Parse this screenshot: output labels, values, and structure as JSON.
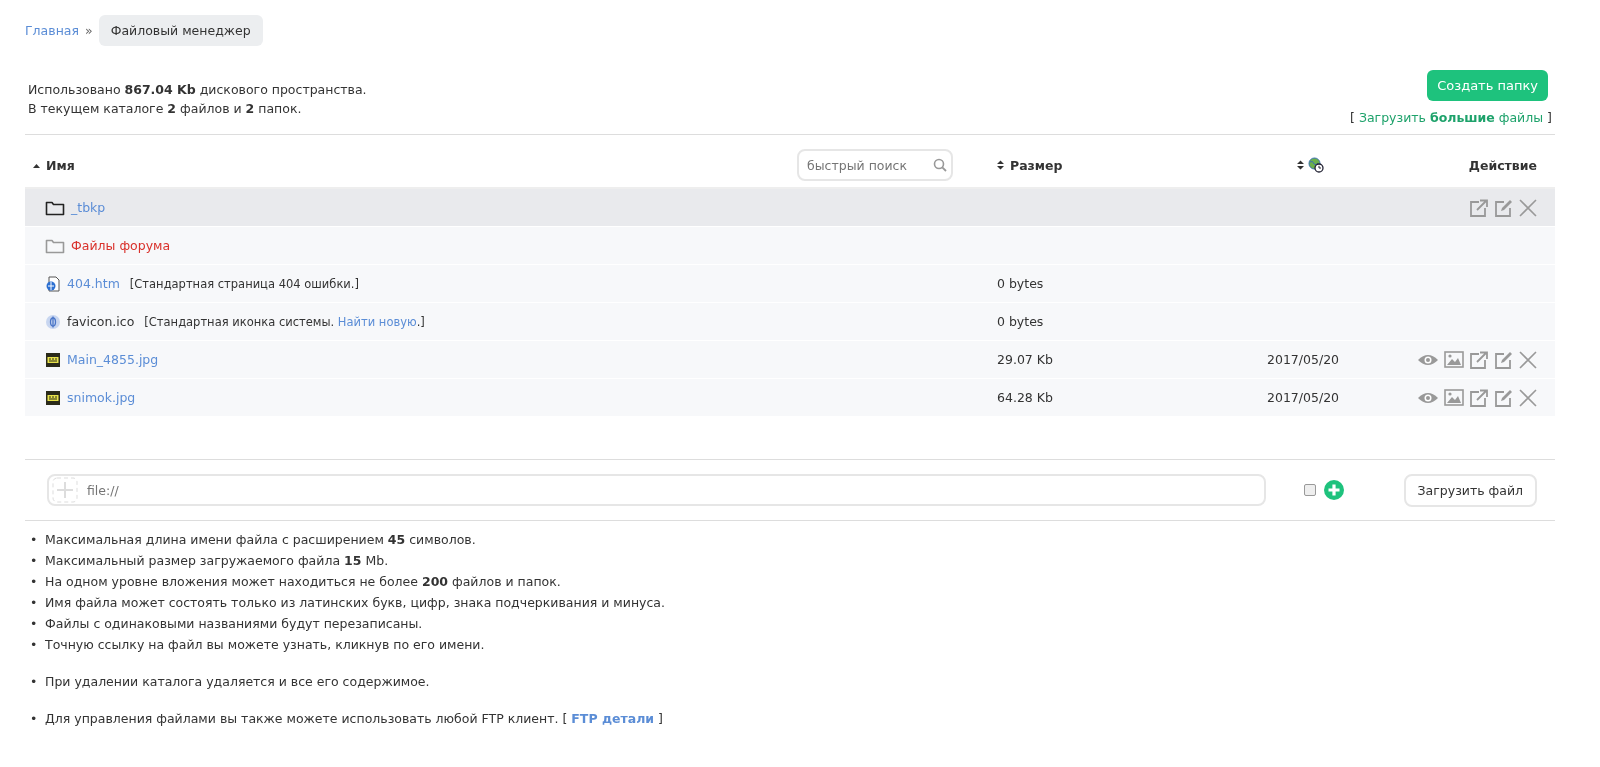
{
  "breadcrumbs": [
    {
      "label": "Главная",
      "selected": false
    },
    {
      "label": "Файловый менеджер",
      "selected": true
    }
  ],
  "breadcrumb_separator": "»",
  "summary": [
    "Использовано **867.04 Kb** дискового пространства.",
    "В текущем каталоге **2** файлов и **2** папок."
  ],
  "create_folder_button": "Создать папку",
  "large_upload": {
    "open": "[",
    "text": "Загрузить **большие** файлы",
    "close": "]"
  },
  "table": {
    "columns": [
      {
        "kind": "name",
        "label": "Имя",
        "sorted": true
      },
      {
        "kind": "search",
        "placeholder": "быстрый поиск"
      },
      {
        "kind": "size",
        "label": "Размер",
        "sorted": false
      },
      {
        "kind": "date",
        "sorted": false
      },
      {
        "kind": "actions",
        "label": "Действие"
      }
    ],
    "rows": [
      {
        "kind": "folder",
        "name": "_tbkp",
        "color": "#5b8dd6",
        "selected": true,
        "actions": [
          {
            "kind": "open"
          },
          {
            "kind": "edit"
          },
          {
            "kind": "delete"
          }
        ]
      },
      {
        "kind": "folder",
        "name": "Файлы форума",
        "color": "#d9312b",
        "selected": false,
        "actions": []
      },
      {
        "kind": "html",
        "name": "404.htm",
        "color": "#5b8dd6",
        "selected": false,
        "note": {
          "text": "[Стандартная страница 404 ошибки.]"
        },
        "size": "0 bytes",
        "actions": []
      },
      {
        "kind": "ico",
        "name": "favicon.ico",
        "color": "#333333",
        "selected": false,
        "note": {
          "text": "[Стандартная иконка системы. ",
          "link": "Найти новую",
          "end": ".]"
        },
        "size": "0 bytes",
        "actions": []
      },
      {
        "kind": "image",
        "name": "Main_4855.jpg",
        "color": "#5b8dd6",
        "selected": false,
        "size": "29.07 Kb",
        "date": "2017/05/20",
        "actions": [
          {
            "kind": "view"
          },
          {
            "kind": "image"
          },
          {
            "kind": "open"
          },
          {
            "kind": "edit"
          },
          {
            "kind": "delete"
          }
        ]
      },
      {
        "kind": "image",
        "name": "snimok.jpg",
        "color": "#5b8dd6",
        "selected": false,
        "size": "64.28 Kb",
        "date": "2017/05/20",
        "actions": [
          {
            "kind": "view"
          },
          {
            "kind": "image"
          },
          {
            "kind": "open"
          },
          {
            "kind": "edit"
          },
          {
            "kind": "delete"
          }
        ]
      }
    ]
  },
  "upload": {
    "placeholder": "file://",
    "checked": false,
    "button": "Загрузить файл"
  },
  "bullet": "•",
  "rules": [
    [
      {
        "text": "Максимальная длина имени файла с расширением **45** символов."
      },
      {
        "text": "Максимальный размер загружаемого файла **15** Mb."
      },
      {
        "text": "На одном уровне вложения может находиться не более **200** файлов и папок."
      },
      {
        "text": "Имя файла может состоять только из латинских букв, цифр, знака подчеркивания и минуса."
      },
      {
        "text": "Файлы с одинаковыми названиями будут перезаписаны."
      },
      {
        "text": "Точную ссылку на файл вы можете узнать, кликнув по его имени."
      }
    ],
    [
      {
        "text": "При удалении каталога удаляется и все его содержимое."
      }
    ],
    [
      {
        "text": "Для управления файлами вы также можете использовать любой FTP клиент. [ ",
        "link": "FTP детали",
        "end": " ]"
      }
    ]
  ]
}
